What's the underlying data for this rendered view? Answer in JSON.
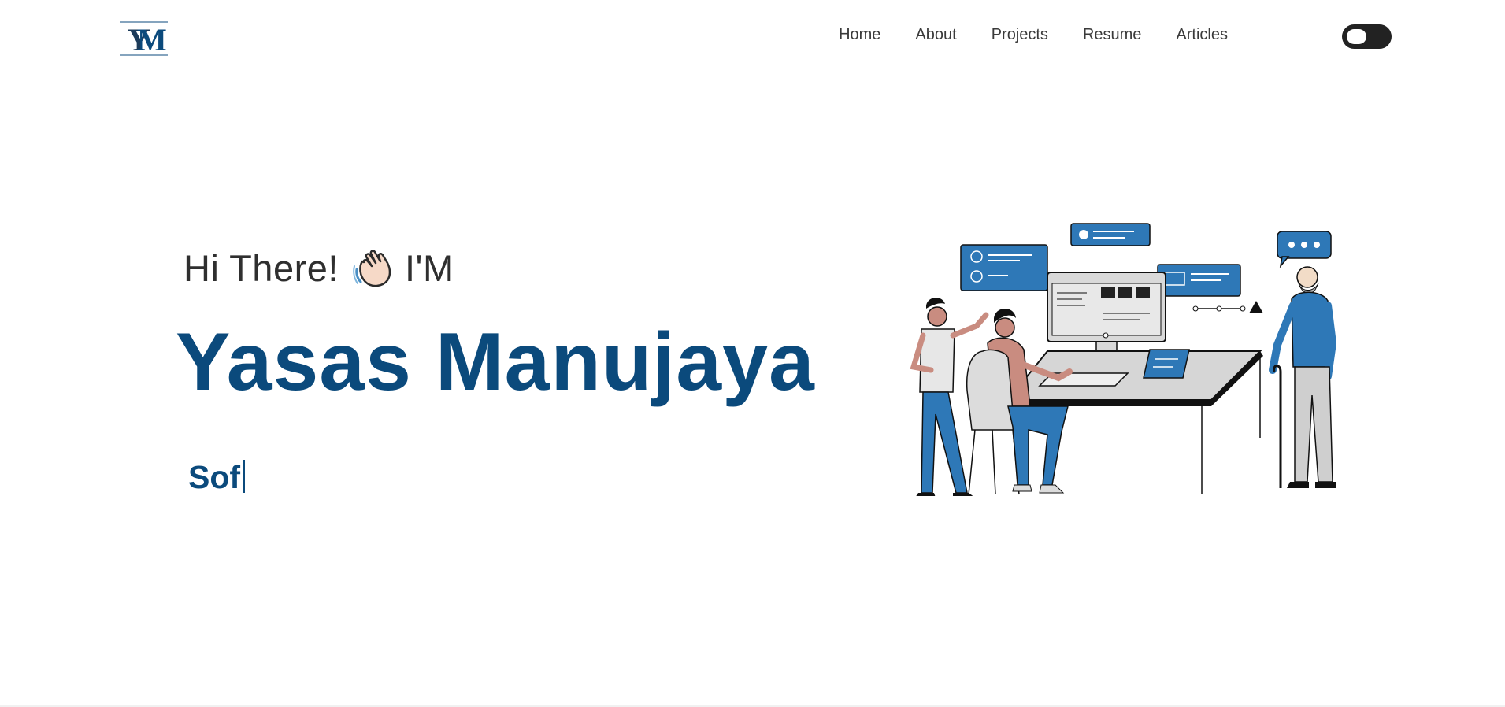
{
  "brand": {
    "logo_icon": "ym-monogram-logo"
  },
  "nav": {
    "items": [
      {
        "label": "Home"
      },
      {
        "label": "About"
      },
      {
        "label": "Projects"
      },
      {
        "label": "Resume"
      },
      {
        "label": "Articles"
      }
    ],
    "theme_toggle_icon": "dark-mode-toggle"
  },
  "hero": {
    "greeting_prefix": "Hi There!",
    "greeting_icon": "waving-hand-icon",
    "greeting_suffix": "I'M",
    "name": "Yasas Manujaya",
    "typed_text": "Sof",
    "illustration_icon": "developers-at-workstation-illustration"
  },
  "colors": {
    "primary": "#0b4a7c",
    "illustration_blue": "#2e78b7",
    "text": "#333333",
    "toggle": "#222222"
  }
}
